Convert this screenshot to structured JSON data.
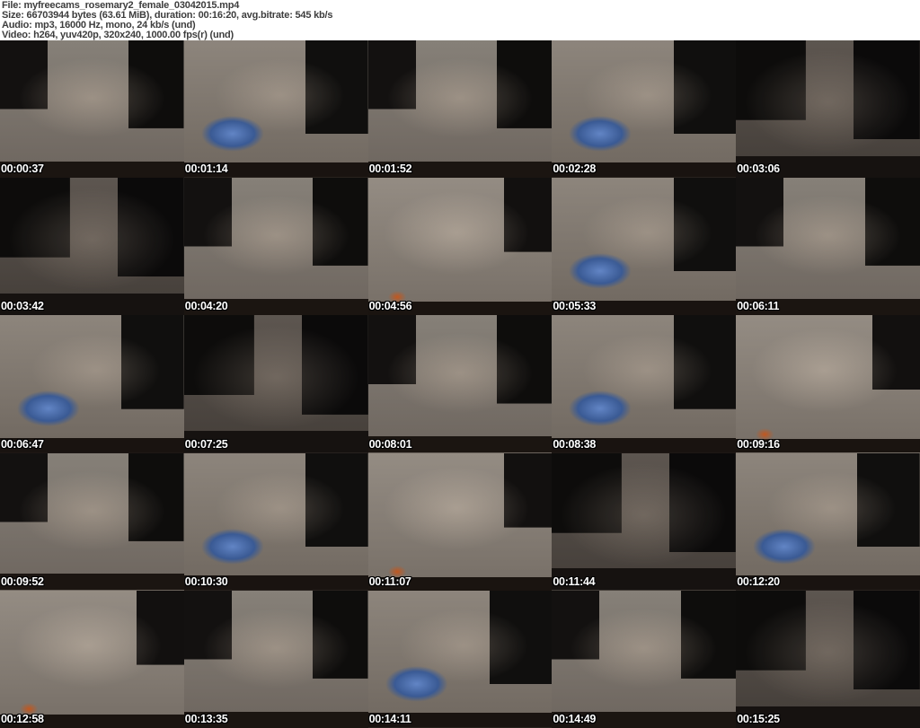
{
  "header": {
    "file": "File: myfreecams_rosemary2_female_03042015.mp4",
    "size": "Size: 66703944 bytes (63.61 MiB), duration: 00:16:20, avg.bitrate: 545 kb/s",
    "audio": "Audio: mp3, 16000 Hz, mono, 24 kb/s (und)",
    "video": "Video: h264, yuv420p, 320x240, 1000.00 fps(r) (und)"
  },
  "colors": {
    "header_bg": "#ffffff",
    "header_text": "#3d3d3d",
    "timestamp_text": "#ffffff",
    "timestamp_outline": "#000000",
    "screen_glow": "#3a5a94"
  },
  "thumbnails": [
    {
      "timestamp": "00:00:37"
    },
    {
      "timestamp": "00:01:14"
    },
    {
      "timestamp": "00:01:52"
    },
    {
      "timestamp": "00:02:28"
    },
    {
      "timestamp": "00:03:06"
    },
    {
      "timestamp": "00:03:42"
    },
    {
      "timestamp": "00:04:20"
    },
    {
      "timestamp": "00:04:56"
    },
    {
      "timestamp": "00:05:33"
    },
    {
      "timestamp": "00:06:11"
    },
    {
      "timestamp": "00:06:47"
    },
    {
      "timestamp": "00:07:25"
    },
    {
      "timestamp": "00:08:01"
    },
    {
      "timestamp": "00:08:38"
    },
    {
      "timestamp": "00:09:16"
    },
    {
      "timestamp": "00:09:52"
    },
    {
      "timestamp": "00:10:30"
    },
    {
      "timestamp": "00:11:07"
    },
    {
      "timestamp": "00:11:44"
    },
    {
      "timestamp": "00:12:20"
    },
    {
      "timestamp": "00:12:58"
    },
    {
      "timestamp": "00:13:35"
    },
    {
      "timestamp": "00:14:11"
    },
    {
      "timestamp": "00:14:49"
    },
    {
      "timestamp": "00:15:25"
    }
  ]
}
